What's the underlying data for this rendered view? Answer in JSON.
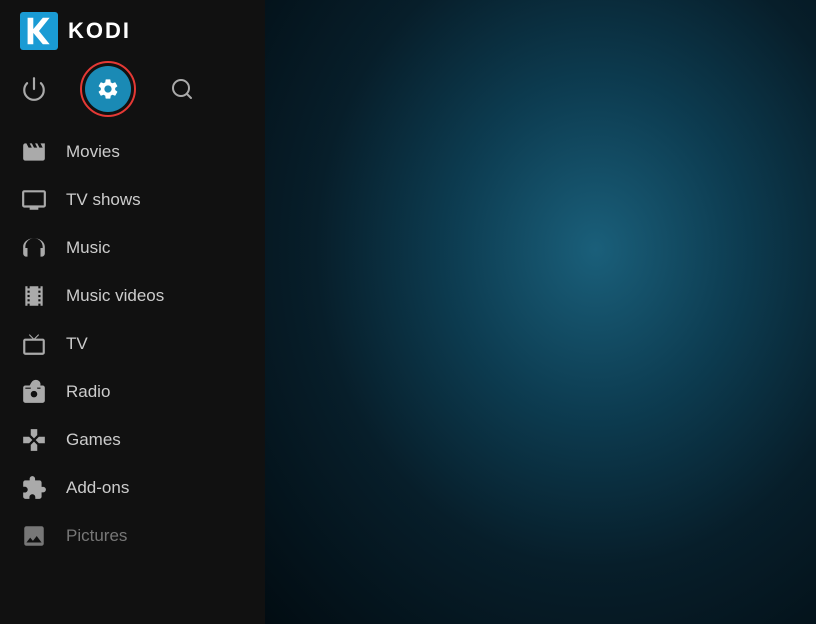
{
  "app": {
    "name": "KODI"
  },
  "topIcons": [
    {
      "id": "power",
      "label": "Power"
    },
    {
      "id": "settings",
      "label": "Settings"
    },
    {
      "id": "search",
      "label": "Search"
    }
  ],
  "navItems": [
    {
      "id": "movies",
      "label": "Movies",
      "icon": "movies"
    },
    {
      "id": "tv-shows",
      "label": "TV shows",
      "icon": "tv-shows"
    },
    {
      "id": "music",
      "label": "Music",
      "icon": "music"
    },
    {
      "id": "music-videos",
      "label": "Music videos",
      "icon": "music-videos"
    },
    {
      "id": "tv",
      "label": "TV",
      "icon": "tv"
    },
    {
      "id": "radio",
      "label": "Radio",
      "icon": "radio"
    },
    {
      "id": "games",
      "label": "Games",
      "icon": "games"
    },
    {
      "id": "add-ons",
      "label": "Add-ons",
      "icon": "add-ons"
    },
    {
      "id": "pictures",
      "label": "Pictures",
      "icon": "pictures",
      "dimmed": true
    }
  ]
}
